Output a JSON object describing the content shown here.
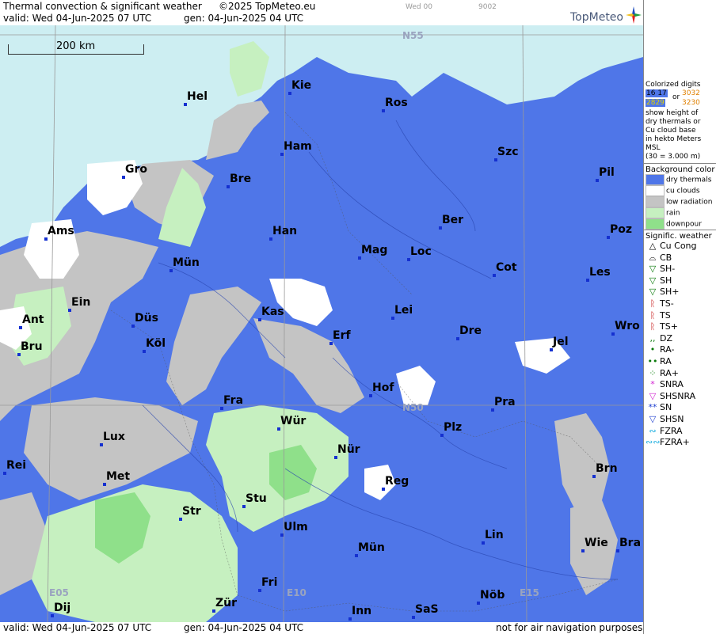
{
  "header": {
    "title": "Thermal convection & significant weather",
    "copyright": "©2025 TopMeteo.eu",
    "valid": "valid:  Wed  04-Jun-2025  07 UTC",
    "gen": "gen: 04-Jun-2025 04 UTC",
    "run_tag": "Wed 00",
    "code": "9002",
    "logo": "TopMeteo"
  },
  "footer": {
    "valid": "valid:  Wed  04-Jun-2025  07 UTC",
    "gen": "gen: 04-Jun-2025 04 UTC",
    "disclaimer": "not for air navigation purposes"
  },
  "map": {
    "scale_label": "200 km",
    "lat_labels": [
      "N55",
      "N50"
    ],
    "lon_labels": [
      "E05",
      "E10",
      "E15"
    ],
    "cities": [
      "Hel",
      "Kie",
      "Ros",
      "Ham",
      "Szc",
      "Gro",
      "Bre",
      "Pil",
      "Ams",
      "Han",
      "Ber",
      "Poz",
      "Mag",
      "Loc",
      "Mün",
      "Cot",
      "Les",
      "Ein",
      "Kas",
      "Lei",
      "Ant",
      "Düs",
      "Wro",
      "Bru",
      "Köl",
      "Erf",
      "Dre",
      "Jel",
      "Hof",
      "Fra",
      "Pra",
      "Lux",
      "Wür",
      "Plz",
      "Rei",
      "Nür",
      "Met",
      "Reg",
      "Brn",
      "Stu",
      "Str",
      "Ulm",
      "Lin",
      "Wie",
      "Bra",
      "Mün",
      "Fri",
      "Dij",
      "Zür",
      "Inn",
      "SaS",
      "Nöb"
    ]
  },
  "legend": {
    "colorized_title": "Colorized digits",
    "digits_a": "16 17",
    "digits_b": "3032",
    "digits_or": "or",
    "digits_c": "2829",
    "digits_d": "3230",
    "desc_lines": [
      "show height of",
      "dry thermals or",
      "Cu cloud base",
      "in hekto Meters",
      "MSL",
      "(30 = 3.000 m)"
    ],
    "bg_title": "Background color",
    "bg_items": [
      {
        "label": "dry thermals",
        "color": "#4f76e8"
      },
      {
        "label": "cu clouds",
        "color": "#ffffff"
      },
      {
        "label": "low radiation",
        "color": "#c4c4c4"
      },
      {
        "label": "rain",
        "color": "#c6f0c0"
      },
      {
        "label": "downpour",
        "color": "#8fe08a"
      }
    ],
    "sig_title": "Signific. weather",
    "sig_items": [
      {
        "sym": "△",
        "label": "Cu Cong",
        "color": "#000000"
      },
      {
        "sym": "⌓",
        "label": "CB",
        "color": "#000000"
      },
      {
        "sym": "▽",
        "label": "SH-",
        "color": "#0a7a0a"
      },
      {
        "sym": "▽",
        "label": "SH",
        "color": "#0a7a0a"
      },
      {
        "sym": "▽",
        "label": "SH+",
        "color": "#0a7a0a"
      },
      {
        "sym": "ᚱ",
        "label": "TS-",
        "color": "#c00000"
      },
      {
        "sym": "ᚱ",
        "label": "TS",
        "color": "#c00000"
      },
      {
        "sym": "ᚱ",
        "label": "TS+",
        "color": "#c00000"
      },
      {
        "sym": ",,",
        "label": "DZ",
        "color": "#0a7a0a"
      },
      {
        "sym": "•",
        "label": "RA-",
        "color": "#0a7a0a"
      },
      {
        "sym": "••",
        "label": "RA",
        "color": "#0a7a0a"
      },
      {
        "sym": "⁘",
        "label": "RA+",
        "color": "#0a7a0a"
      },
      {
        "sym": "*",
        "label": "SNRA",
        "color": "#d020d0"
      },
      {
        "sym": "▽",
        "label": "SHSNRA",
        "color": "#d020d0"
      },
      {
        "sym": "**",
        "label": "SN",
        "color": "#2040d0"
      },
      {
        "sym": "▽",
        "label": "SHSN",
        "color": "#2040d0"
      },
      {
        "sym": "∾",
        "label": "FZRA",
        "color": "#20b0e0"
      },
      {
        "sym": "∾∾",
        "label": "FZRA+",
        "color": "#20b0e0"
      }
    ]
  }
}
